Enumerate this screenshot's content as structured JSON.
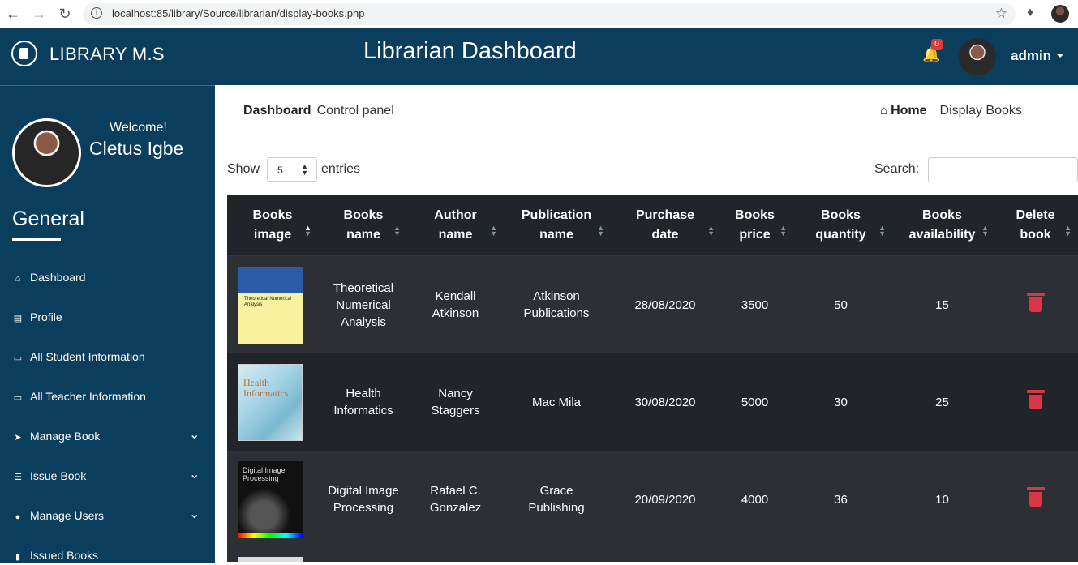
{
  "browser": {
    "url": "localhost:85/library/Source/librarian/display-books.php"
  },
  "header": {
    "brand": "LIBRARY M.S",
    "title": "Librarian Dashboard",
    "notification_count": "0",
    "user": "admin"
  },
  "sidebar": {
    "welcome": "Welcome!",
    "username": "Cletus Igbe",
    "section": "General",
    "items": [
      {
        "label": "Dashboard",
        "icon": "home-icon"
      },
      {
        "label": "Profile",
        "icon": "id-card-icon"
      },
      {
        "label": "All Student Information",
        "icon": "monitor-icon"
      },
      {
        "label": "All Teacher Information",
        "icon": "monitor-icon"
      },
      {
        "label": "Manage Book",
        "icon": "paper-plane-icon"
      },
      {
        "label": "Issue Book",
        "icon": "list-icon"
      },
      {
        "label": "Manage Users",
        "icon": "users-icon"
      },
      {
        "label": "Issued Books",
        "icon": "bookmark-icon"
      }
    ]
  },
  "breadcrumb": {
    "title": "Dashboard",
    "subtitle": "Control panel",
    "home": "Home",
    "current": "Display Books"
  },
  "table_controls": {
    "show_label": "Show",
    "page_size": "5",
    "entries_label": "entries",
    "search_label": "Search:"
  },
  "table": {
    "columns": [
      [
        "Books",
        "image"
      ],
      [
        "Books",
        "name"
      ],
      [
        "Author",
        "name"
      ],
      [
        "Publication",
        "name"
      ],
      [
        "Purchase",
        "date"
      ],
      [
        "Books",
        "price"
      ],
      [
        "Books",
        "quantity"
      ],
      [
        "Books",
        "availability"
      ],
      [
        "Delete",
        "book"
      ]
    ],
    "rows": [
      {
        "cover_text": "Theoretical Numerical Analysis",
        "name": [
          "Theoretical",
          "Numerical",
          "Analysis"
        ],
        "author": [
          "Kendall",
          "Atkinson"
        ],
        "publication": [
          "Atkinson",
          "Publications"
        ],
        "date": "28/08/2020",
        "price": "3500",
        "quantity": "50",
        "availability": "15"
      },
      {
        "cover_text": "Health Informatics",
        "name": [
          "Health",
          "Informatics"
        ],
        "author": [
          "Nancy",
          "Staggers"
        ],
        "publication": [
          "Mac Mila"
        ],
        "date": "30/08/2020",
        "price": "5000",
        "quantity": "30",
        "availability": "25"
      },
      {
        "cover_text": "Digital Image Processing",
        "name": [
          "Digital Image",
          "Processing"
        ],
        "author": [
          "Rafael C.",
          "Gonzalez"
        ],
        "publication": [
          "Grace",
          "Publishing"
        ],
        "date": "20/09/2020",
        "price": "4000",
        "quantity": "36",
        "availability": "10"
      }
    ]
  },
  "colors": {
    "navy": "#0b3d5c",
    "table_dark": "#212529",
    "table_stripe": "#2c3034",
    "danger": "#dc3545"
  }
}
